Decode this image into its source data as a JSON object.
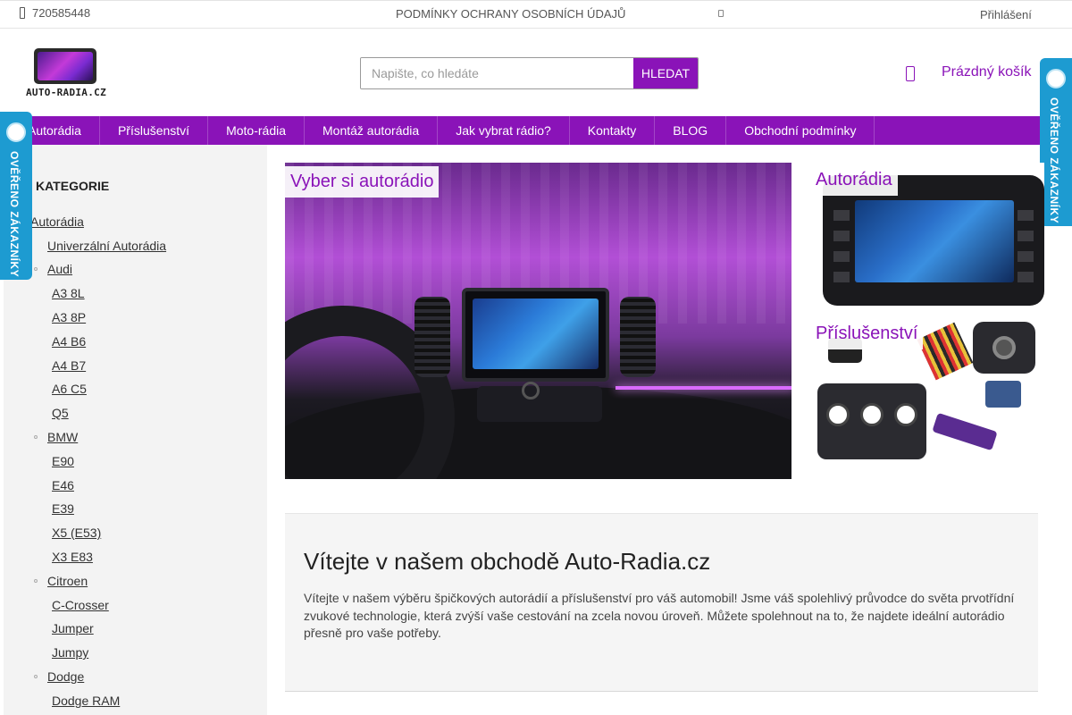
{
  "topbar": {
    "phone": "720585448",
    "privacy_link": "PODMÍNKY OCHRANY OSOBNÍCH ÚDAJŮ",
    "login": "Přihlášení"
  },
  "header": {
    "logo_text": "AUTO-RADIA.CZ",
    "search_placeholder": "Napište, co hledáte",
    "search_button": "HLEDAT",
    "cart_label": "Prázdný košík"
  },
  "nav": {
    "items": [
      "Autorádia",
      "Příslušenství",
      "Moto-rádia",
      "Montáž autorádia",
      "Jak vybrat rádio?",
      "Kontakty",
      "BLOG",
      "Obchodní podmínky"
    ]
  },
  "badges": {
    "left_text": "OVĚŘENO ZÁKAZNÍKY",
    "right_text": "OVĚŘENO ZÁKAZNÍKY"
  },
  "sidebar": {
    "title": "KATEGORIE",
    "items": [
      {
        "label": "Autorádia",
        "level": 0
      },
      {
        "label": "Univerzální Autorádia",
        "level": 1
      },
      {
        "label": "Audi",
        "level": 1
      },
      {
        "label": "A3 8L",
        "level": 2
      },
      {
        "label": "A3 8P",
        "level": 2
      },
      {
        "label": "A4 B6",
        "level": 2
      },
      {
        "label": "A4 B7",
        "level": 2
      },
      {
        "label": "A6 C5",
        "level": 2
      },
      {
        "label": "Q5",
        "level": 2
      },
      {
        "label": "BMW",
        "level": 1
      },
      {
        "label": "E90",
        "level": 2
      },
      {
        "label": "E46",
        "level": 2
      },
      {
        "label": "E39",
        "level": 2
      },
      {
        "label": "X5 (E53)",
        "level": 2
      },
      {
        "label": "X3 E83",
        "level": 2
      },
      {
        "label": "Citroen",
        "level": 1
      },
      {
        "label": "C-Crosser",
        "level": 2
      },
      {
        "label": "Jumper",
        "level": 2
      },
      {
        "label": "Jumpy",
        "level": 2
      },
      {
        "label": "Dodge",
        "level": 1
      },
      {
        "label": "Dodge RAM",
        "level": 2
      }
    ]
  },
  "banners": {
    "hero_label": "Vyber si autorádio",
    "promo1_label": "Autorádia",
    "promo2_label": "Příslušenství"
  },
  "welcome": {
    "heading": "Vítejte v našem obchodě Auto-Radia.cz",
    "text": "Vítejte v našem výběru špičkových autorádií a příslušenství pro váš automobil! Jsme váš spolehlivý průvodce do světa prvotřídní zvukové technologie, která zvýší vaše cestování na zcela novou úroveň. Můžete spolehnout na to, že najdete ideální autorádio přesně pro vaše potřeby."
  },
  "colors": {
    "brand": "#8a13b8",
    "badge": "#1d9bd1"
  }
}
